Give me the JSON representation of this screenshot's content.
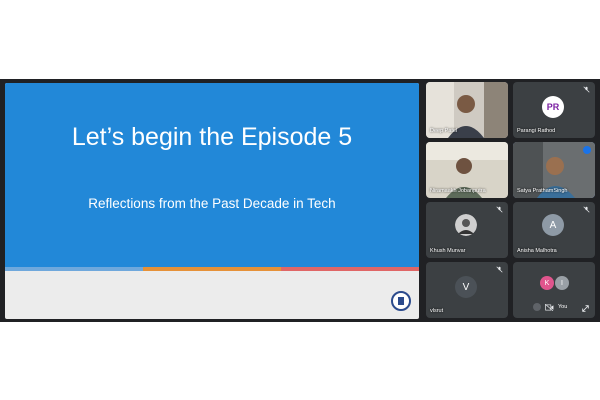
{
  "slide": {
    "title": "Let’s begin the Episode 5",
    "subtitle": "Reflections from the Past Decade in Tech"
  },
  "participants": [
    {
      "name": "Deep Patel",
      "type": "video"
    },
    {
      "name": "Parangi Rathod",
      "initials": "PR",
      "type": "avatar",
      "muted": true
    },
    {
      "name": "Niramaakh Jobanputra",
      "type": "video"
    },
    {
      "name": "Satya PrathamSingh",
      "type": "video"
    },
    {
      "name": "Khush Munvar",
      "type": "avatar-photo",
      "muted": true
    },
    {
      "name": "Anisha Malhotra",
      "initials": "A",
      "type": "avatar",
      "muted": true
    },
    {
      "name": "vlsrut",
      "initials": "V",
      "type": "avatar",
      "muted": true
    }
  ],
  "self_tile": {
    "avatars": [
      "K",
      "I"
    ],
    "you_label": "You"
  },
  "colors": {
    "meet_background": "#202124",
    "tile_background": "#3c4043",
    "slide_blue": "#2288d8",
    "stripe_colors": [
      "#6fa8dc",
      "#e69138",
      "#e06666"
    ]
  },
  "icons": [
    "mic-off-icon",
    "more-options-icon",
    "camera-off-icon",
    "expand-icon"
  ]
}
